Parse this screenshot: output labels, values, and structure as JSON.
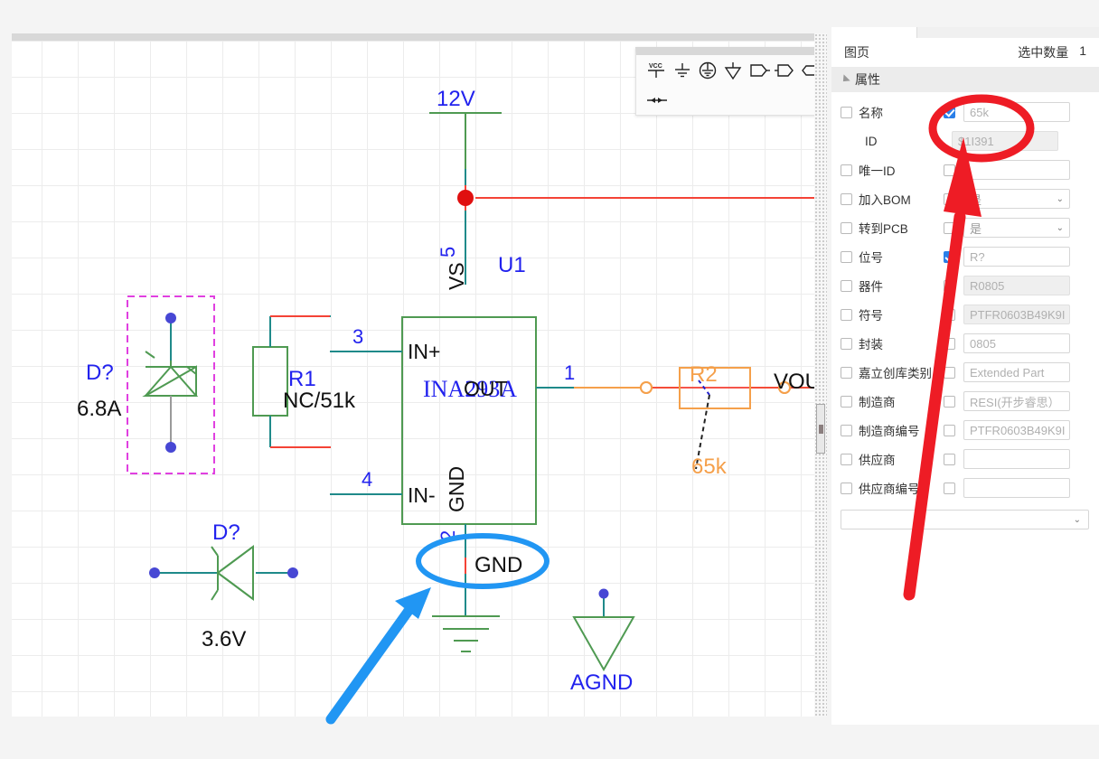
{
  "app": {
    "canvas_background": "#ffffff",
    "page_background": "#f4f4f4"
  },
  "tool_palette": {
    "name": "power-port-palette",
    "items": [
      {
        "name": "vcc-port-icon",
        "label": "VCC"
      },
      {
        "name": "gnd-port-icon",
        "label": "GND"
      },
      {
        "name": "earth-circle-port-icon",
        "label": "EARTH"
      },
      {
        "name": "agnd-triangle-port-icon",
        "label": "AGND"
      },
      {
        "name": "net-flag-right-icon",
        "label": "NET-FLAG-OUT"
      },
      {
        "name": "net-flag-left-icon",
        "label": "NET-FLAG-IN"
      },
      {
        "name": "net-label-hex-icon",
        "label": "NET-LABEL"
      },
      {
        "name": "bidirectional-port-icon",
        "label": "BIDIR"
      }
    ]
  },
  "panel": {
    "tab_left": "",
    "tab_right": "",
    "title": "图页",
    "count_label": "选中数量",
    "count_value": "1",
    "section_title": "属性",
    "rows": [
      {
        "label": "名称",
        "label_checked": false,
        "indented": false,
        "value_check": true,
        "value_check_shown": true,
        "value": "65k",
        "type": "input",
        "readonly": false
      },
      {
        "label": "ID",
        "label_checked": null,
        "indented": true,
        "value_check": false,
        "value_check_shown": false,
        "value": "$1I391",
        "type": "input",
        "readonly": true
      },
      {
        "label": "唯一ID",
        "label_checked": false,
        "indented": false,
        "value_check": false,
        "value_check_shown": true,
        "value": "",
        "type": "input",
        "readonly": false
      },
      {
        "label": "加入BOM",
        "label_checked": false,
        "indented": false,
        "value_check": false,
        "value_check_shown": true,
        "value": "是",
        "type": "select",
        "readonly": false
      },
      {
        "label": "转到PCB",
        "label_checked": false,
        "indented": false,
        "value_check": false,
        "value_check_shown": true,
        "value": "是",
        "type": "select",
        "readonly": false
      },
      {
        "label": "位号",
        "label_checked": false,
        "indented": false,
        "value_check": true,
        "value_check_shown": true,
        "value": "R?",
        "type": "input",
        "readonly": false
      },
      {
        "label": "器件",
        "label_checked": false,
        "indented": false,
        "value_check": false,
        "value_check_shown": true,
        "value": "R0805",
        "type": "input",
        "readonly": true
      },
      {
        "label": "符号",
        "label_checked": false,
        "indented": false,
        "value_check": false,
        "value_check_shown": true,
        "value": "PTFR0603B49K9I",
        "type": "input",
        "readonly": true
      },
      {
        "label": "封装",
        "label_checked": false,
        "indented": false,
        "value_check": false,
        "value_check_shown": true,
        "value": "0805",
        "type": "input",
        "readonly": false
      },
      {
        "label": "嘉立创库类别",
        "label_checked": false,
        "indented": false,
        "value_check": false,
        "value_check_shown": true,
        "value": "Extended Part",
        "type": "input",
        "readonly": false
      },
      {
        "label": "制造商",
        "label_checked": false,
        "indented": false,
        "value_check": false,
        "value_check_shown": true,
        "value": "RESI(开步睿思）",
        "type": "input",
        "readonly": false
      },
      {
        "label": "制造商编号",
        "label_checked": false,
        "indented": false,
        "value_check": false,
        "value_check_shown": true,
        "value": "PTFR0603B49K9I",
        "type": "input",
        "readonly": false
      },
      {
        "label": "供应商",
        "label_checked": false,
        "indented": false,
        "value_check": false,
        "value_check_shown": true,
        "value": "",
        "type": "input",
        "readonly": false
      },
      {
        "label": "供应商编号",
        "label_checked": false,
        "indented": false,
        "value_check": false,
        "value_check_shown": true,
        "value": "",
        "type": "input",
        "readonly": false
      }
    ],
    "bottom_select_value": ""
  },
  "schematic": {
    "colors": {
      "wire_teal": "#1f8a8a",
      "wire_red": "#f44336",
      "wire_orange": "#f5a04b",
      "symbol_green": "#4f9a52",
      "label_blue": "#2222ee",
      "pin_text": "#111111",
      "selection_magenta": "#e040e0",
      "junction_red": "#e01010"
    },
    "nets": {
      "vcc_label": "12V",
      "gnd_label": "GND",
      "agnd_label": "AGND",
      "vout_label": "VOU"
    },
    "components": [
      {
        "name": "zener-diode-d-68a",
        "designator": "D?",
        "value": "6.8A",
        "selected": true,
        "orientation": "vertical"
      },
      {
        "name": "resistor-r1",
        "designator": "R1",
        "value": "NC/51k",
        "selected": false,
        "orientation": "vertical"
      },
      {
        "name": "ic-u1-ina293a",
        "designator": "U1",
        "value": "INA293A",
        "pins": [
          {
            "number": "3",
            "label": "IN+"
          },
          {
            "number": "4",
            "label": "IN-"
          },
          {
            "number": "5",
            "label": "VS"
          },
          {
            "number": "2",
            "label": "GND"
          },
          {
            "number": "1",
            "label": "OUT"
          }
        ]
      },
      {
        "name": "resistor-r2",
        "designator": "R2",
        "value": "65k",
        "selected": true,
        "orientation": "horizontal"
      },
      {
        "name": "zener-diode-d-36v",
        "designator": "D?",
        "value": "3.6V",
        "selected": false,
        "orientation": "horizontal"
      }
    ]
  },
  "annotations": {
    "red_circle": {
      "name": "red-highlight-ellipse",
      "color": "#ee1c25",
      "target": "名称 value field"
    },
    "red_arrow": {
      "name": "red-pointer-arrow",
      "color": "#ee1c25"
    },
    "blue_circle": {
      "name": "blue-highlight-ellipse",
      "color": "#2196f3",
      "target": "GND net label"
    },
    "blue_arrow": {
      "name": "blue-pointer-arrow",
      "color": "#2196f3"
    }
  }
}
